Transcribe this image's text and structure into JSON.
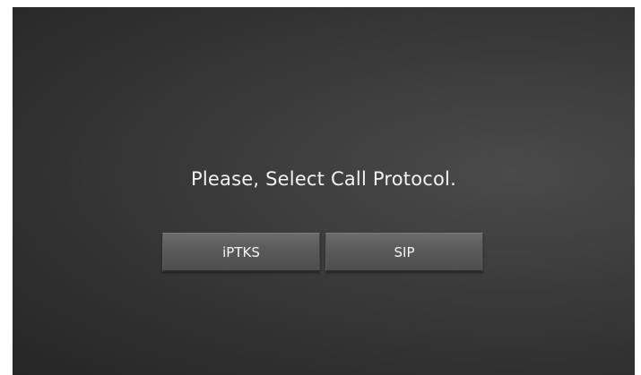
{
  "dialog": {
    "prompt": "Please, Select Call Protocol.",
    "buttons": [
      {
        "label": "iPTKS"
      },
      {
        "label": "SIP"
      }
    ]
  },
  "colors": {
    "background_center": "#4a4a4a",
    "background_edge": "#262626",
    "button_face": "#5a5a5a",
    "text": "#f2f2f2"
  }
}
